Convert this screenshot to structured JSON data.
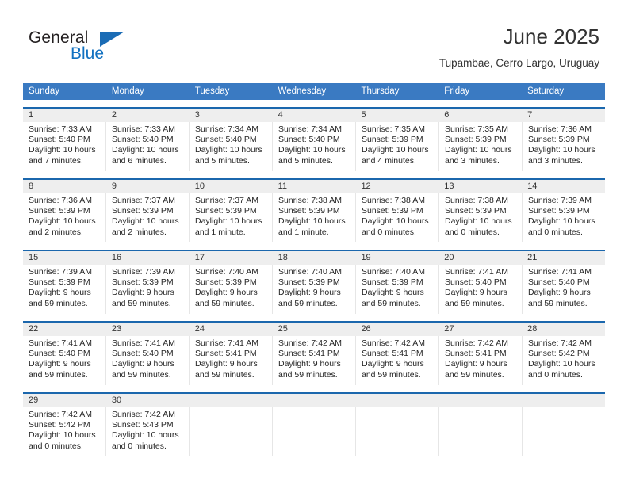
{
  "logo": {
    "word_one": "General",
    "word_two": "Blue",
    "triangle": "blue-triangle"
  },
  "header": {
    "title": "June 2025",
    "subtitle": "Tupambae, Cerro Largo, Uruguay"
  },
  "colors": {
    "header_blue": "#3a7ac2",
    "row_rule_blue": "#1b67ad",
    "date_strip_gray": "#eeeeee",
    "logo_blue": "#1271c1"
  },
  "calendar": {
    "weekdays": [
      "Sunday",
      "Monday",
      "Tuesday",
      "Wednesday",
      "Thursday",
      "Friday",
      "Saturday"
    ],
    "weeks": [
      {
        "days": [
          {
            "date": "1",
            "sunrise": "Sunrise: 7:33 AM",
            "sunset": "Sunset: 5:40 PM",
            "daylight_1": "Daylight: 10 hours",
            "daylight_2": "and 7 minutes."
          },
          {
            "date": "2",
            "sunrise": "Sunrise: 7:33 AM",
            "sunset": "Sunset: 5:40 PM",
            "daylight_1": "Daylight: 10 hours",
            "daylight_2": "and 6 minutes."
          },
          {
            "date": "3",
            "sunrise": "Sunrise: 7:34 AM",
            "sunset": "Sunset: 5:40 PM",
            "daylight_1": "Daylight: 10 hours",
            "daylight_2": "and 5 minutes."
          },
          {
            "date": "4",
            "sunrise": "Sunrise: 7:34 AM",
            "sunset": "Sunset: 5:40 PM",
            "daylight_1": "Daylight: 10 hours",
            "daylight_2": "and 5 minutes."
          },
          {
            "date": "5",
            "sunrise": "Sunrise: 7:35 AM",
            "sunset": "Sunset: 5:39 PM",
            "daylight_1": "Daylight: 10 hours",
            "daylight_2": "and 4 minutes."
          },
          {
            "date": "6",
            "sunrise": "Sunrise: 7:35 AM",
            "sunset": "Sunset: 5:39 PM",
            "daylight_1": "Daylight: 10 hours",
            "daylight_2": "and 3 minutes."
          },
          {
            "date": "7",
            "sunrise": "Sunrise: 7:36 AM",
            "sunset": "Sunset: 5:39 PM",
            "daylight_1": "Daylight: 10 hours",
            "daylight_2": "and 3 minutes."
          }
        ]
      },
      {
        "days": [
          {
            "date": "8",
            "sunrise": "Sunrise: 7:36 AM",
            "sunset": "Sunset: 5:39 PM",
            "daylight_1": "Daylight: 10 hours",
            "daylight_2": "and 2 minutes."
          },
          {
            "date": "9",
            "sunrise": "Sunrise: 7:37 AM",
            "sunset": "Sunset: 5:39 PM",
            "daylight_1": "Daylight: 10 hours",
            "daylight_2": "and 2 minutes."
          },
          {
            "date": "10",
            "sunrise": "Sunrise: 7:37 AM",
            "sunset": "Sunset: 5:39 PM",
            "daylight_1": "Daylight: 10 hours",
            "daylight_2": "and 1 minute."
          },
          {
            "date": "11",
            "sunrise": "Sunrise: 7:38 AM",
            "sunset": "Sunset: 5:39 PM",
            "daylight_1": "Daylight: 10 hours",
            "daylight_2": "and 1 minute."
          },
          {
            "date": "12",
            "sunrise": "Sunrise: 7:38 AM",
            "sunset": "Sunset: 5:39 PM",
            "daylight_1": "Daylight: 10 hours",
            "daylight_2": "and 0 minutes."
          },
          {
            "date": "13",
            "sunrise": "Sunrise: 7:38 AM",
            "sunset": "Sunset: 5:39 PM",
            "daylight_1": "Daylight: 10 hours",
            "daylight_2": "and 0 minutes."
          },
          {
            "date": "14",
            "sunrise": "Sunrise: 7:39 AM",
            "sunset": "Sunset: 5:39 PM",
            "daylight_1": "Daylight: 10 hours",
            "daylight_2": "and 0 minutes."
          }
        ]
      },
      {
        "days": [
          {
            "date": "15",
            "sunrise": "Sunrise: 7:39 AM",
            "sunset": "Sunset: 5:39 PM",
            "daylight_1": "Daylight: 9 hours",
            "daylight_2": "and 59 minutes."
          },
          {
            "date": "16",
            "sunrise": "Sunrise: 7:39 AM",
            "sunset": "Sunset: 5:39 PM",
            "daylight_1": "Daylight: 9 hours",
            "daylight_2": "and 59 minutes."
          },
          {
            "date": "17",
            "sunrise": "Sunrise: 7:40 AM",
            "sunset": "Sunset: 5:39 PM",
            "daylight_1": "Daylight: 9 hours",
            "daylight_2": "and 59 minutes."
          },
          {
            "date": "18",
            "sunrise": "Sunrise: 7:40 AM",
            "sunset": "Sunset: 5:39 PM",
            "daylight_1": "Daylight: 9 hours",
            "daylight_2": "and 59 minutes."
          },
          {
            "date": "19",
            "sunrise": "Sunrise: 7:40 AM",
            "sunset": "Sunset: 5:39 PM",
            "daylight_1": "Daylight: 9 hours",
            "daylight_2": "and 59 minutes."
          },
          {
            "date": "20",
            "sunrise": "Sunrise: 7:41 AM",
            "sunset": "Sunset: 5:40 PM",
            "daylight_1": "Daylight: 9 hours",
            "daylight_2": "and 59 minutes."
          },
          {
            "date": "21",
            "sunrise": "Sunrise: 7:41 AM",
            "sunset": "Sunset: 5:40 PM",
            "daylight_1": "Daylight: 9 hours",
            "daylight_2": "and 59 minutes."
          }
        ]
      },
      {
        "days": [
          {
            "date": "22",
            "sunrise": "Sunrise: 7:41 AM",
            "sunset": "Sunset: 5:40 PM",
            "daylight_1": "Daylight: 9 hours",
            "daylight_2": "and 59 minutes."
          },
          {
            "date": "23",
            "sunrise": "Sunrise: 7:41 AM",
            "sunset": "Sunset: 5:40 PM",
            "daylight_1": "Daylight: 9 hours",
            "daylight_2": "and 59 minutes."
          },
          {
            "date": "24",
            "sunrise": "Sunrise: 7:41 AM",
            "sunset": "Sunset: 5:41 PM",
            "daylight_1": "Daylight: 9 hours",
            "daylight_2": "and 59 minutes."
          },
          {
            "date": "25",
            "sunrise": "Sunrise: 7:42 AM",
            "sunset": "Sunset: 5:41 PM",
            "daylight_1": "Daylight: 9 hours",
            "daylight_2": "and 59 minutes."
          },
          {
            "date": "26",
            "sunrise": "Sunrise: 7:42 AM",
            "sunset": "Sunset: 5:41 PM",
            "daylight_1": "Daylight: 9 hours",
            "daylight_2": "and 59 minutes."
          },
          {
            "date": "27",
            "sunrise": "Sunrise: 7:42 AM",
            "sunset": "Sunset: 5:41 PM",
            "daylight_1": "Daylight: 9 hours",
            "daylight_2": "and 59 minutes."
          },
          {
            "date": "28",
            "sunrise": "Sunrise: 7:42 AM",
            "sunset": "Sunset: 5:42 PM",
            "daylight_1": "Daylight: 10 hours",
            "daylight_2": "and 0 minutes."
          }
        ]
      },
      {
        "days": [
          {
            "date": "29",
            "sunrise": "Sunrise: 7:42 AM",
            "sunset": "Sunset: 5:42 PM",
            "daylight_1": "Daylight: 10 hours",
            "daylight_2": "and 0 minutes."
          },
          {
            "date": "30",
            "sunrise": "Sunrise: 7:42 AM",
            "sunset": "Sunset: 5:43 PM",
            "daylight_1": "Daylight: 10 hours",
            "daylight_2": "and 0 minutes."
          },
          {
            "date": "",
            "sunrise": "",
            "sunset": "",
            "daylight_1": "",
            "daylight_2": ""
          },
          {
            "date": "",
            "sunrise": "",
            "sunset": "",
            "daylight_1": "",
            "daylight_2": ""
          },
          {
            "date": "",
            "sunrise": "",
            "sunset": "",
            "daylight_1": "",
            "daylight_2": ""
          },
          {
            "date": "",
            "sunrise": "",
            "sunset": "",
            "daylight_1": "",
            "daylight_2": ""
          },
          {
            "date": "",
            "sunrise": "",
            "sunset": "",
            "daylight_1": "",
            "daylight_2": ""
          }
        ]
      }
    ]
  }
}
